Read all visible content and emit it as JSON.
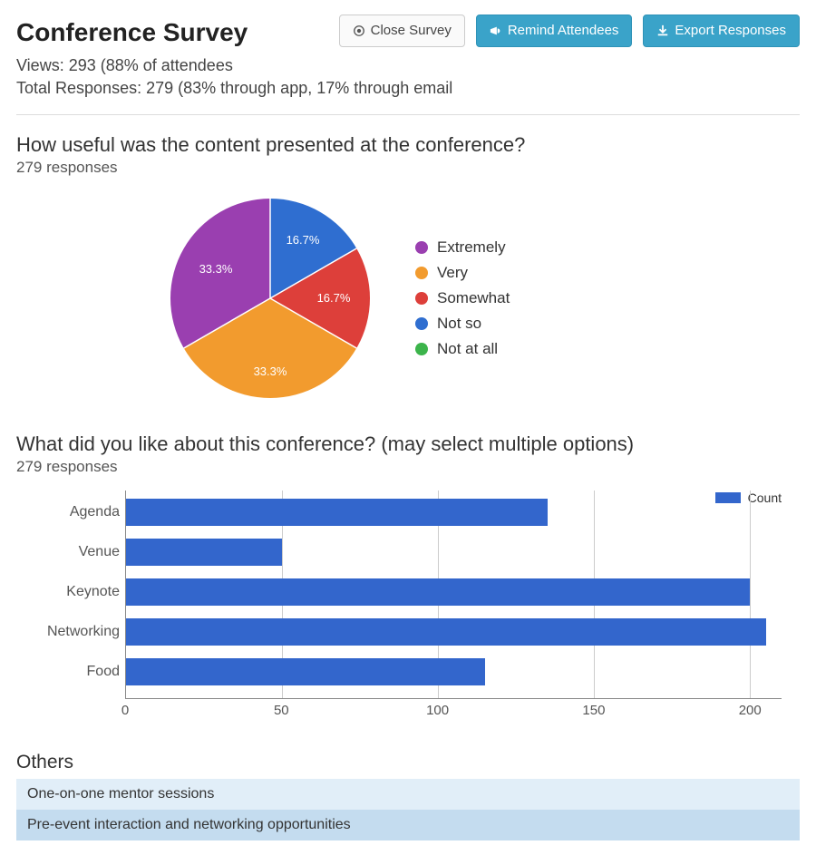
{
  "header": {
    "title": "Conference Survey",
    "close_label": "Close Survey",
    "remind_label": "Remind Attendees",
    "export_label": "Export Responses"
  },
  "meta": {
    "views_line": "Views: 293 (88% of attendees",
    "responses_line": "Total Responses: 279 (83% through app, 17% through email"
  },
  "q1": {
    "title": "How useful was the content presented at the conference?",
    "sub": "279 responses",
    "legend": [
      {
        "label": "Extremely",
        "color": "#9a3fb0"
      },
      {
        "label": "Very",
        "color": "#f29b2e"
      },
      {
        "label": "Somewhat",
        "color": "#dd3f3a"
      },
      {
        "label": "Not so",
        "color": "#2f6ed0"
      },
      {
        "label": "Not at all",
        "color": "#3cb44b"
      }
    ],
    "slice_labels": {
      "notso": "16.7%",
      "somewhat": "16.7%",
      "very": "33.3%",
      "extremely": "33.3%"
    }
  },
  "q2": {
    "title": "What did you like about this conference? (may select multiple options)",
    "sub": "279 responses",
    "legend_label": "Count",
    "categories": [
      "Agenda",
      "Venue",
      "Keynote",
      "Networking",
      "Food"
    ],
    "x_ticks": [
      "0",
      "50",
      "100",
      "150",
      "200"
    ]
  },
  "others": {
    "title": "Others",
    "items": [
      "One-on-one mentor sessions",
      "Pre-event interaction and networking opportunities"
    ]
  },
  "chart_data": [
    {
      "type": "pie",
      "title": "How useful was the content presented at the conference?",
      "series": [
        {
          "name": "Extremely",
          "value": 33.3,
          "color": "#9a3fb0"
        },
        {
          "name": "Very",
          "value": 33.3,
          "color": "#f29b2e"
        },
        {
          "name": "Somewhat",
          "value": 16.7,
          "color": "#dd3f3a"
        },
        {
          "name": "Not so",
          "value": 16.7,
          "color": "#2f6ed0"
        },
        {
          "name": "Not at all",
          "value": 0.0,
          "color": "#3cb44b"
        }
      ]
    },
    {
      "type": "bar",
      "orientation": "horizontal",
      "title": "What did you like about this conference? (may select multiple options)",
      "xlabel": "",
      "ylabel": "",
      "xlim": [
        0,
        210
      ],
      "categories": [
        "Agenda",
        "Venue",
        "Keynote",
        "Networking",
        "Food"
      ],
      "series": [
        {
          "name": "Count",
          "values": [
            135,
            50,
            200,
            205,
            115
          ],
          "color": "#3366cc"
        }
      ]
    }
  ]
}
